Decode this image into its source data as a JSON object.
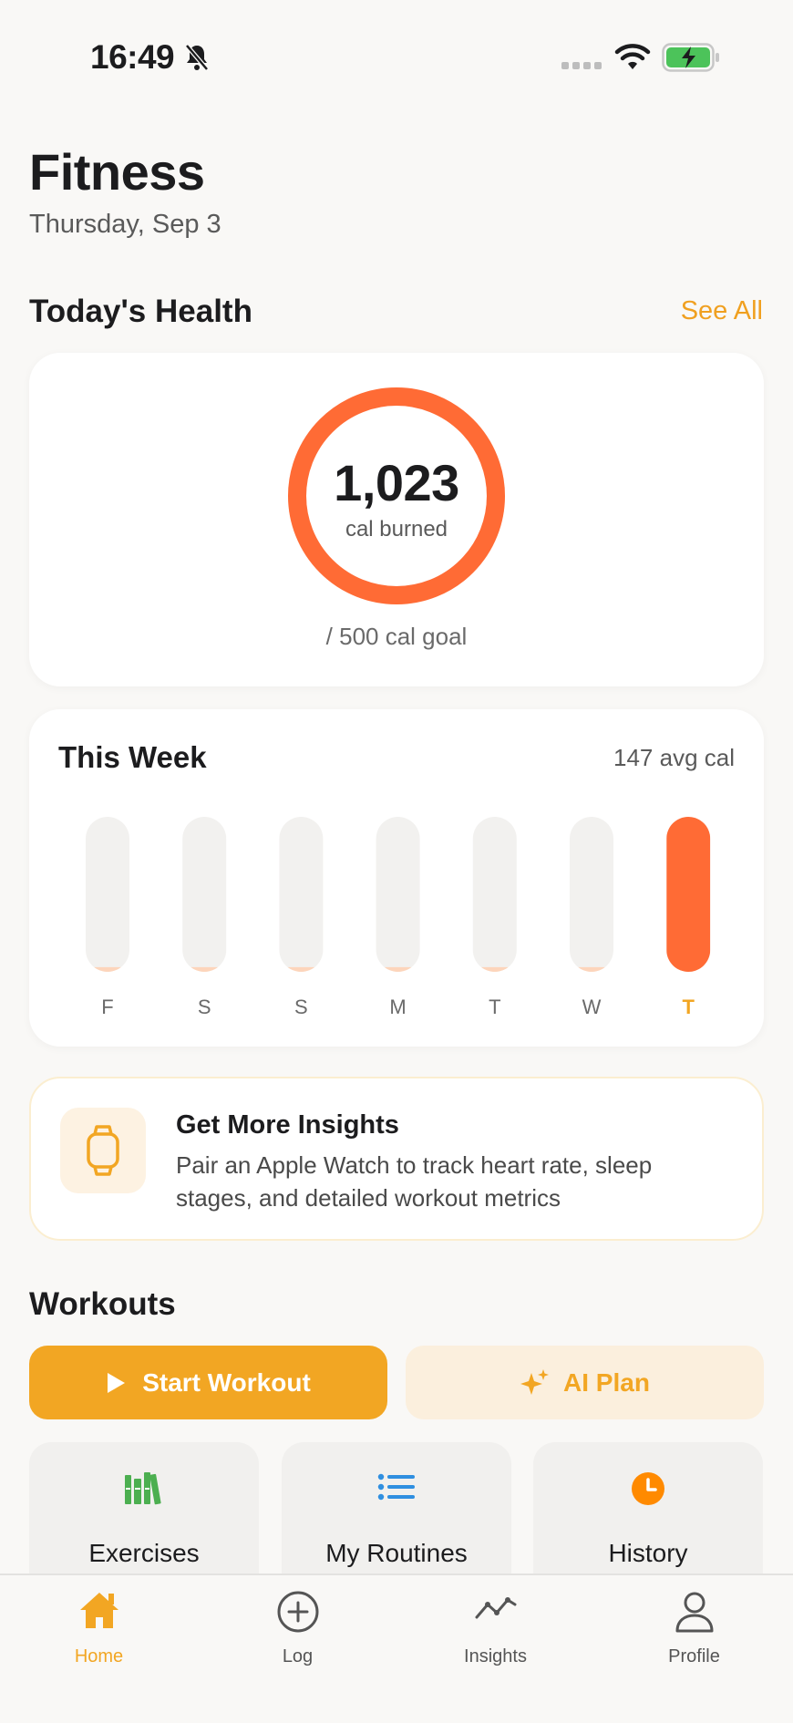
{
  "status_bar": {
    "time": "16:49"
  },
  "header": {
    "title": "Fitness",
    "date": "Thursday, Sep 3"
  },
  "health": {
    "section_title": "Today's Health",
    "see_all": "See All",
    "ring_value": "1,023",
    "ring_label": "cal burned",
    "goal": "/ 500 cal goal",
    "ring_progress": 1.0,
    "ring_color": "#ff6b35"
  },
  "week": {
    "title": "This Week",
    "avg": "147 avg cal",
    "days": [
      {
        "label": "F",
        "value": 0.03,
        "active": false
      },
      {
        "label": "S",
        "value": 0.03,
        "active": false
      },
      {
        "label": "S",
        "value": 0.03,
        "active": false
      },
      {
        "label": "M",
        "value": 0.03,
        "active": false
      },
      {
        "label": "T",
        "value": 0.03,
        "active": false
      },
      {
        "label": "W",
        "value": 0.03,
        "active": false
      },
      {
        "label": "T",
        "value": 1.0,
        "active": true
      }
    ],
    "active_color": "#ff6b35",
    "inactive_color": "#fdd5bb",
    "track_color": "#f2f1ef"
  },
  "insight": {
    "title": "Get More Insights",
    "body": "Pair an Apple Watch to track heart rate, sleep stages, and detailed workout metrics",
    "icon": "watch-icon"
  },
  "workouts": {
    "section_title": "Workouts",
    "start_label": "Start Workout",
    "ai_label": "AI Plan",
    "tiles": [
      {
        "label": "Exercises",
        "icon": "books-icon",
        "color": "#4caf50"
      },
      {
        "label": "My Routines",
        "icon": "list-icon",
        "color": "#2f8fe0"
      },
      {
        "label": "History",
        "icon": "clock-icon",
        "color": "#ff8a00"
      }
    ]
  },
  "tabs": [
    {
      "label": "Home",
      "icon": "home-icon",
      "active": true
    },
    {
      "label": "Log",
      "icon": "plus-circle-icon",
      "active": false
    },
    {
      "label": "Insights",
      "icon": "chart-line-icon",
      "active": false
    },
    {
      "label": "Profile",
      "icon": "person-icon",
      "active": false
    }
  ],
  "colors": {
    "accent": "#f2a623",
    "ring": "#ff6b35"
  }
}
